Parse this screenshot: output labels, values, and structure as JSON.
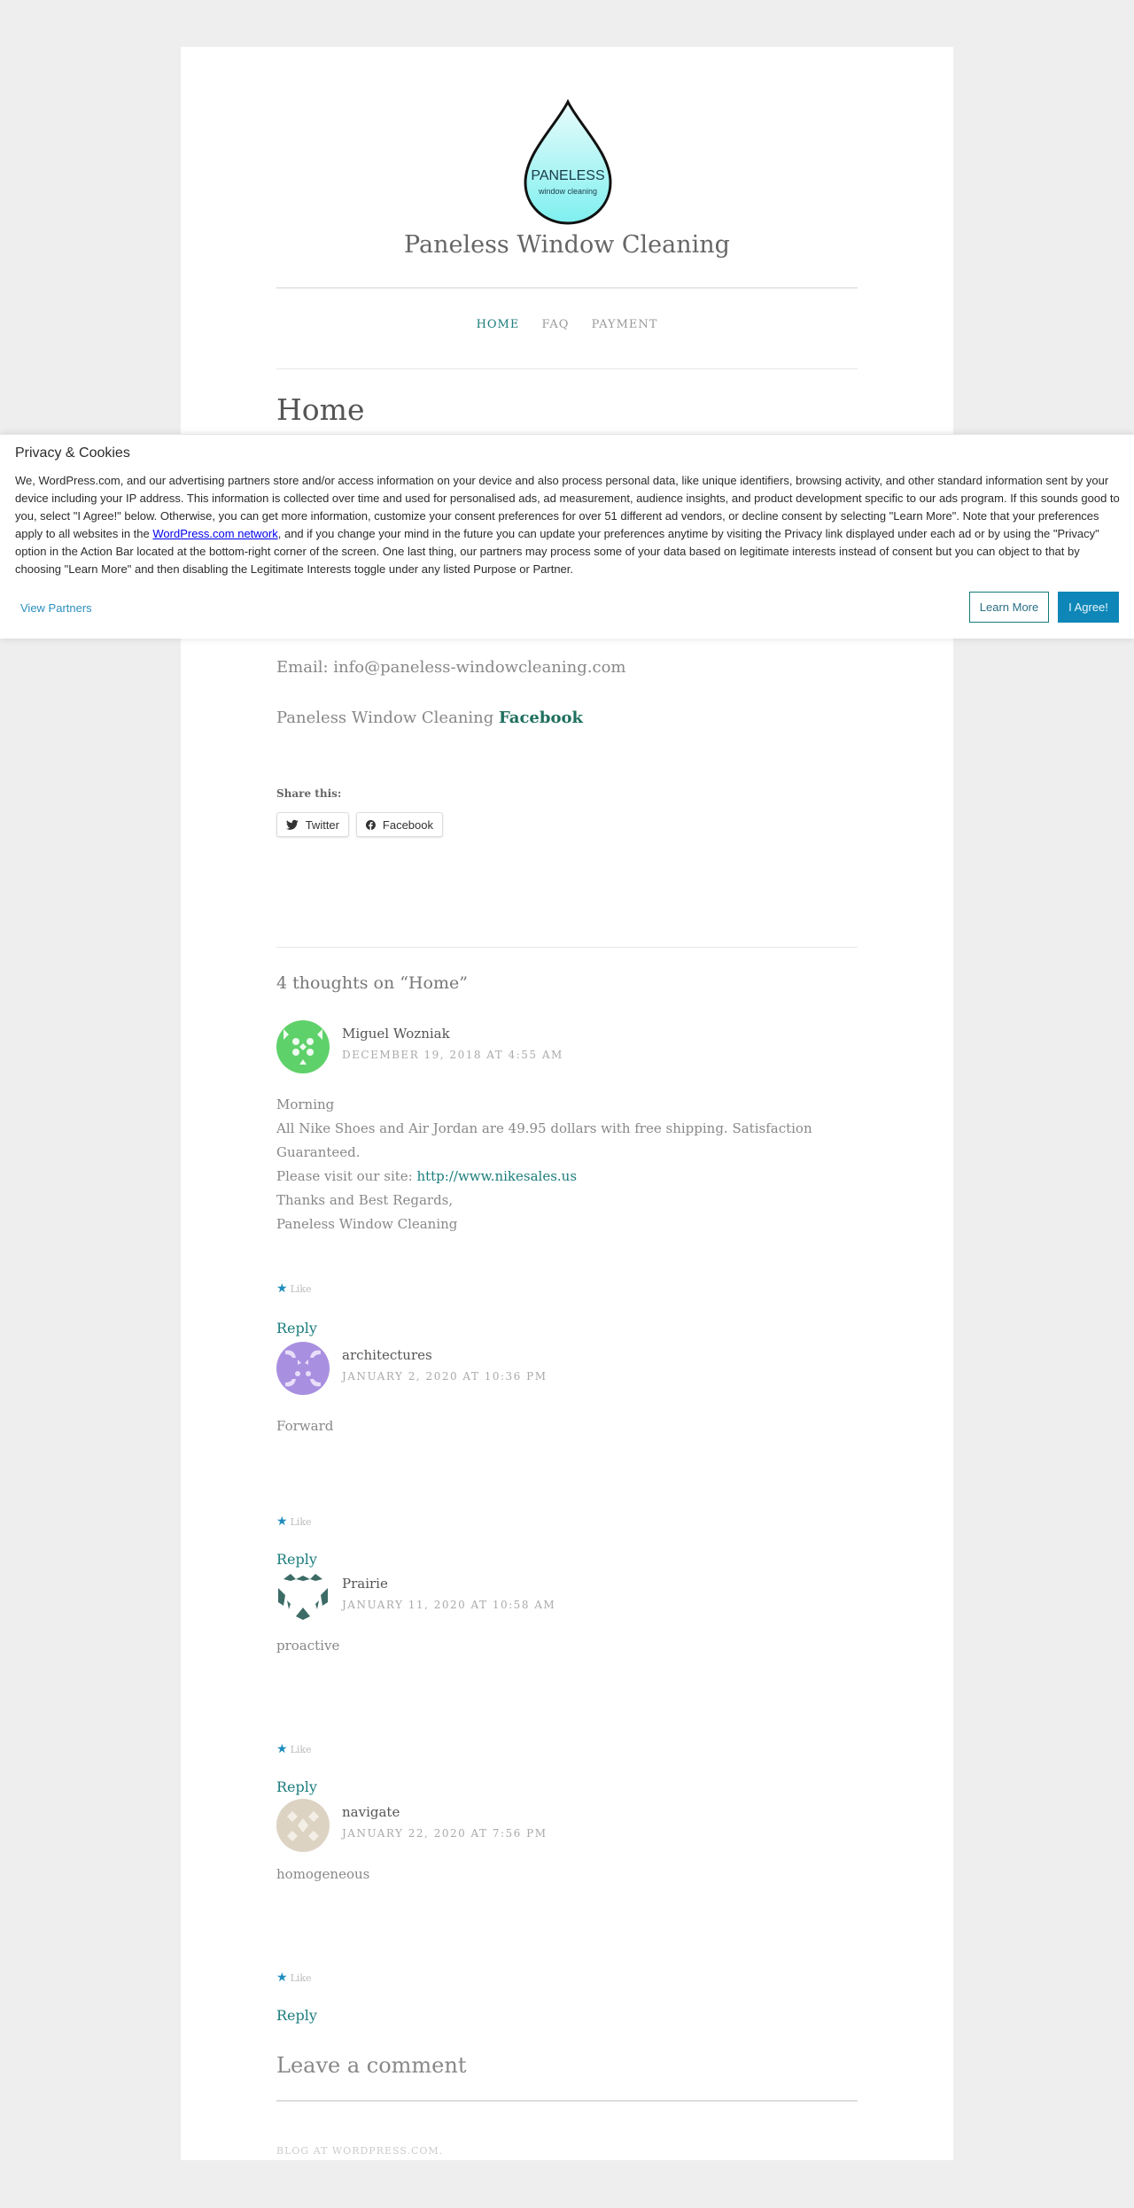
{
  "site": {
    "title": "Paneless Window Cleaning",
    "logo_text_main": "PANELESS",
    "logo_text_sub": "window cleaning"
  },
  "nav": {
    "items": [
      {
        "label": "HOME",
        "active": true
      },
      {
        "label": "FAQ",
        "active": false
      },
      {
        "label": "PAYMENT",
        "active": false
      }
    ]
  },
  "page": {
    "title": "Home",
    "email_line": "Email: info@paneless-windowcleaning.com",
    "facebook_prefix": "Paneless Window Cleaning ",
    "facebook_link": "Facebook"
  },
  "share": {
    "label": "Share this:",
    "buttons": [
      {
        "label": "Twitter",
        "icon": "twitter-icon"
      },
      {
        "label": "Facebook",
        "icon": "facebook-icon"
      }
    ]
  },
  "comments": {
    "title": "4 thoughts on “Home”",
    "like_label": "Like",
    "reply_label": "Reply",
    "items": [
      {
        "author": "Miguel Wozniak",
        "date": "DECEMBER 19, 2018 AT 4:55 AM",
        "avatar_color": "#5fd16a",
        "lines": [
          "Morning",
          "All Nike Shoes and Air Jordan are 49.95 dollars with free shipping. Satisfaction Guaranteed.",
          "Please visit our site: ",
          "Thanks and Best Regards,",
          "Paneless Window Cleaning"
        ],
        "link": "http://www.nikesales.us"
      },
      {
        "author": "architectures",
        "date": "JANUARY 2, 2020 AT 10:36 PM",
        "avatar_color": "#a98fe0",
        "lines": [
          "Forward"
        ]
      },
      {
        "author": "Prairie",
        "date": "JANUARY 11, 2020 AT 10:58 AM",
        "avatar_color": "#3d6b66",
        "lines": [
          "proactive"
        ]
      },
      {
        "author": "navigate",
        "date": "JANUARY 22, 2020 AT 7:56 PM",
        "avatar_color": "#cfc5b3",
        "lines": [
          "homogeneous"
        ]
      }
    ]
  },
  "leave_comment": "Leave a comment",
  "footer": {
    "credit": "BLOG AT WORDPRESS.COM."
  },
  "cookie": {
    "title": "Privacy & Cookies",
    "text_before_link": "We, WordPress.com, and our advertising partners store and/or access information on your device and also process personal data, like unique identifiers, browsing activity, and other standard information sent by your device including your IP address. This information is collected over time and used for personalised ads, ad measurement, audience insights, and product development specific to our ads program. If this sounds good to you, select \"I Agree!\" below. Otherwise, you can get more information, customize your consent preferences for over 51 different ad vendors, or decline consent by selecting \"Learn More\". Note that your preferences apply to all websites in the ",
    "link_text": "WordPress.com network",
    "text_after_link": ", and if you change your mind in the future you can update your preferences anytime by visiting the Privacy link displayed under each ad or by using the \"Privacy\" option in the Action Bar located at the bottom-right corner of the screen. One last thing, our partners may process some of your data based on legitimate interests instead of consent but you can object to that by choosing \"Learn More\" and then disabling the Legitimate Interests toggle under any listed Purpose or Partner.",
    "view_partners": "View Partners",
    "learn_more": "Learn More",
    "agree": "I Agree!"
  },
  "colors": {
    "accent": "#1c7c7c",
    "agree_button": "#0e87b8",
    "like_star": "#1e8cbe"
  }
}
